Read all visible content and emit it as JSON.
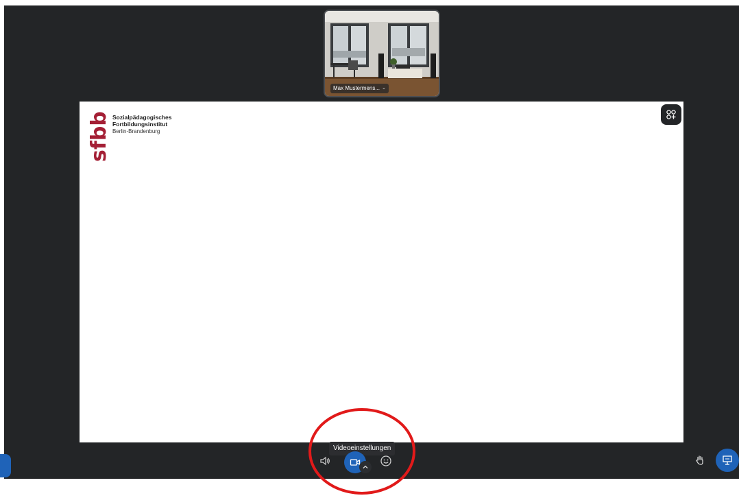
{
  "meeting": {
    "participant_name": "Max Mustermens...",
    "participant_menu_icon": "chevron-down-icon"
  },
  "slide": {
    "logo_mark": "sfbb",
    "logo_line1": "Sozialpädagogisches",
    "logo_line2": "Fortbildungsinstitut",
    "logo_line3": "Berlin-Brandenburg",
    "logo_color": "#a41f35"
  },
  "toolbar": {
    "video_settings_tooltip": "Videoeinstellungen",
    "audio_icon": "speaker-icon",
    "video_icon": "camera-icon",
    "video_settings_icon": "chevron-up-icon",
    "reactions_icon": "smiley-icon",
    "raise_hand_icon": "hand-icon",
    "presentation_icon": "presentation-icon",
    "apps_icon": "apps-add-icon"
  },
  "colors": {
    "app_background": "#232527",
    "accent_blue": "#1f63b8",
    "annotation_red": "#e11a1a"
  }
}
